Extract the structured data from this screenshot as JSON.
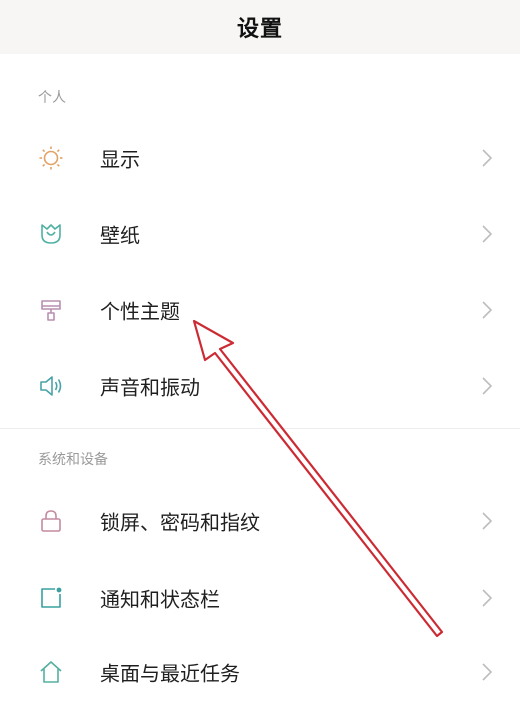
{
  "header": {
    "title": "设置"
  },
  "sections": [
    {
      "label": "个人",
      "items": [
        {
          "label": "显示",
          "icon": "sun-icon"
        },
        {
          "label": "壁纸",
          "icon": "tulip-icon"
        },
        {
          "label": "个性主题",
          "icon": "paint-roller-icon"
        },
        {
          "label": "声音和振动",
          "icon": "speaker-icon"
        }
      ]
    },
    {
      "label": "系统和设备",
      "items": [
        {
          "label": "锁屏、密码和指纹",
          "icon": "lock-icon"
        },
        {
          "label": "通知和状态栏",
          "icon": "notification-icon"
        },
        {
          "label": "桌面与最近任务",
          "icon": "home-icon"
        }
      ]
    }
  ],
  "colors": {
    "sun": "#e2a268",
    "tulip": "#4fb0a3",
    "paint_roller": "#b88fb0",
    "speaker": "#4aa3a8",
    "lock": "#c58aa1",
    "notification": "#3aa0a2",
    "home": "#55b0a0",
    "annotation_arrow": "#cc2b33"
  }
}
